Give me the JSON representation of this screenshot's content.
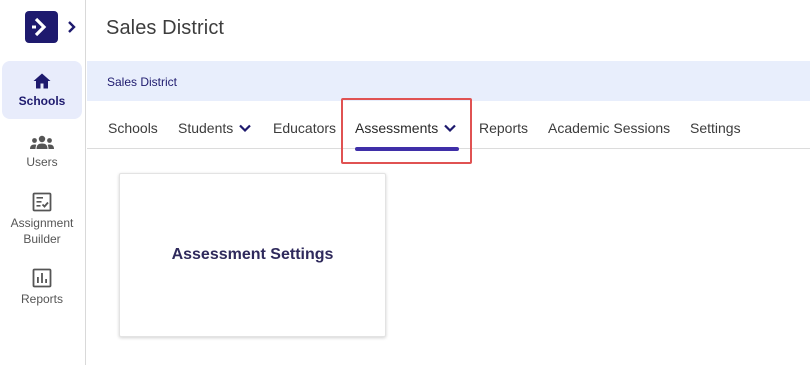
{
  "app": {
    "logo_icon": "arrow-logo-icon",
    "rail_toggle_icon": "chevron-right-icon",
    "brand_color": "#1e1a6e",
    "accent_color": "#3f2fa8"
  },
  "sidebar": {
    "items": [
      {
        "label": "Schools",
        "icon": "home-icon",
        "active": true
      },
      {
        "label": "Users",
        "icon": "users-icon",
        "active": false
      },
      {
        "label": "Assignment Builder",
        "icon": "assignment-icon",
        "active": false
      },
      {
        "label": "Reports",
        "icon": "bar-chart-icon",
        "active": false
      }
    ]
  },
  "header": {
    "title": "Sales District"
  },
  "breadcrumb": {
    "text": "Sales District"
  },
  "tabs": [
    {
      "label": "Schools",
      "dropdown": false,
      "active": false
    },
    {
      "label": "Students",
      "dropdown": true,
      "active": false
    },
    {
      "label": "Educators",
      "dropdown": false,
      "active": false
    },
    {
      "label": "Assessments",
      "dropdown": true,
      "active": true
    },
    {
      "label": "Reports",
      "dropdown": false,
      "active": false
    },
    {
      "label": "Academic Sessions",
      "dropdown": false,
      "active": false
    },
    {
      "label": "Settings",
      "dropdown": false,
      "active": false
    }
  ],
  "highlight": {
    "color": "#e05252",
    "target": "Assessments"
  },
  "cards": [
    {
      "title": "Assessment Settings"
    }
  ]
}
